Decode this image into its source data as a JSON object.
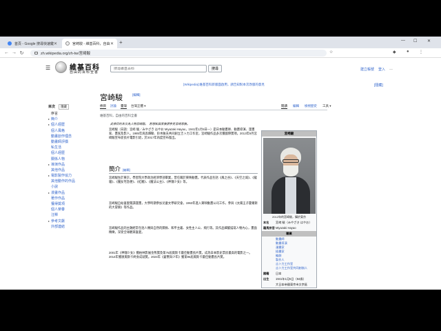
{
  "browser": {
    "tabs": [
      {
        "label": "首頁 - Google 搜尋快速鍵",
        "active": false
      },
      {
        "label": "宮崎駿 - 維基百科，自由的百科全書",
        "active": true
      }
    ],
    "url": "zh.wikipedia.org/zh-tw/宮崎駿",
    "controls": {
      "minimize": "—",
      "maximize": "☐",
      "close": "✕",
      "newtab": "+"
    }
  },
  "wiki": {
    "logo_title": "維基百科",
    "logo_tagline": "自由的百科全書",
    "search_placeholder": "搜尋維基百科",
    "search_button": "搜尋",
    "user_links": [
      "建立帳號",
      "登入",
      "…"
    ],
    "notice": "[Wikipedia]:維基百科新版面啟用，請告知對本次改版的意見",
    "notice_hide": "[隱藏]",
    "sidebar": {
      "title": "目次",
      "hide": "隱藏",
      "items": [
        {
          "label": "序言",
          "sub": false,
          "toggle": ""
        },
        {
          "label": "簡介",
          "sub": false,
          "toggle": "▸"
        },
        {
          "label": "個人經歷",
          "sub": false,
          "toggle": "▸"
        },
        {
          "label": "個人風格",
          "sub": false,
          "toggle": ""
        },
        {
          "label": "動畫創作理念",
          "sub": false,
          "toggle": ""
        },
        {
          "label": "動畫師評價",
          "sub": false,
          "toggle": ""
        },
        {
          "label": "私生活",
          "sub": false,
          "toggle": ""
        },
        {
          "label": "個人經歷",
          "sub": false,
          "toggle": ""
        },
        {
          "label": "關係人物",
          "sub": false,
          "toggle": ""
        },
        {
          "label": "導演作品",
          "sub": false,
          "toggle": "▸"
        },
        {
          "label": "其他作品",
          "sub": false,
          "toggle": ""
        },
        {
          "label": "電影製作協力",
          "sub": false,
          "toggle": "▸"
        },
        {
          "label": "其他動作的作品",
          "sub": false,
          "toggle": ""
        },
        {
          "label": "小說",
          "sub": false,
          "toggle": ""
        },
        {
          "label": "漫畫作品",
          "sub": false,
          "toggle": "▸"
        },
        {
          "label": "著作作品",
          "sub": false,
          "toggle": ""
        },
        {
          "label": "獲得獎項",
          "sub": false,
          "toggle": ""
        },
        {
          "label": "個人榮譽",
          "sub": false,
          "toggle": ""
        },
        {
          "label": "注釋",
          "sub": false,
          "toggle": ""
        },
        {
          "label": "參考文獻",
          "sub": false,
          "toggle": "▸"
        },
        {
          "label": "外部連結",
          "sub": false,
          "toggle": ""
        }
      ]
    },
    "page": {
      "title": "宮崎駿",
      "lang_button": "[編輯]",
      "tabs": [
        "條目",
        "討論",
        "臺灣",
        "台灣正體 ▾"
      ],
      "right_tabs": [
        "閱讀",
        "編輯",
        "檢視歷史",
        "工具 ▾"
      ],
      "from": "維基百科，自由的百科全書",
      "redirect": "維基百科：自由的百科全書",
      "hatnote": "此條目的本文為人物宮崎駿。　若想知其家族請參見宮崎家族。",
      "paragraphs": [
        "宮崎駿（日語：宮﨑 駿／みやざき はやお Miyazaki Hayao，1941年1月5日—）是日本動畫師、動畫導演、漫畫家、畫家及影人。1985年與高畑勳、鈴木敏夫共同創立吉卜力工作室，宮崎駿作品多次獲國際獎項。2013年9月宮崎駿宣布從長片電影引退，於2017年再度宣布復出。",
        "宮崎駿生於東京，學習院大學政治經濟學部畢業，曾任職於東映動畫。代表作品包括《風之谷》、《天空之城》、《龍貓》、《魔女宅急便》、《紅豬》、《魔法公主》、《神隱少女》等。",
        "宮崎駿自幼喜愛閱讀漫畫，大學時期參加兒童文學研究會，1963年進入東映動畫公司工作，參與《太陽王子霍爾斯的大冒險》等作品。",
        "宮崎駿作品的主題經常包括人類與自然的關係、和平主義、女性主人公、飛行等。其作品細膩描寫人物內心，畫面精緻，深受全球觀眾喜愛。",
        "2001年《神隱少女》獲柏林影展金熊獎及第75屆奧斯卡最佳動畫長片獎，成為日本影史票房最高的電影之一。2014年獲頒奧斯卡終身成就獎。2024年《蒼鷺與少年》獲第96屆奧斯卡最佳動畫長片獎。"
      ],
      "section_heading": "簡介",
      "section_edit": "[編輯]"
    },
    "infobox": {
      "title": "宮崎駿",
      "caption": "2012年的宮崎駿，攝於東京",
      "caption_link": "",
      "rows": [
        {
          "k": "本名",
          "v": "宮﨑 駿（みやざき はやお）"
        },
        {
          "k": "羅馬拼音",
          "v": "Miyazaki Hayao"
        }
      ],
      "section": "職業",
      "roles": [
        "動畫師",
        "動畫導演",
        "漫畫家",
        "插畫家",
        "編劇",
        "製作人",
        "吉卜力工作室",
        "吉卜力工作室共同創辦人"
      ],
      "rows2": [
        {
          "k": "國籍",
          "v": "日本"
        },
        {
          "k": "出生",
          "v": "1941年1月5日（84歲）"
        },
        {
          "k": "",
          "v": "大日本帝國東京市文京區"
        }
      ]
    }
  }
}
